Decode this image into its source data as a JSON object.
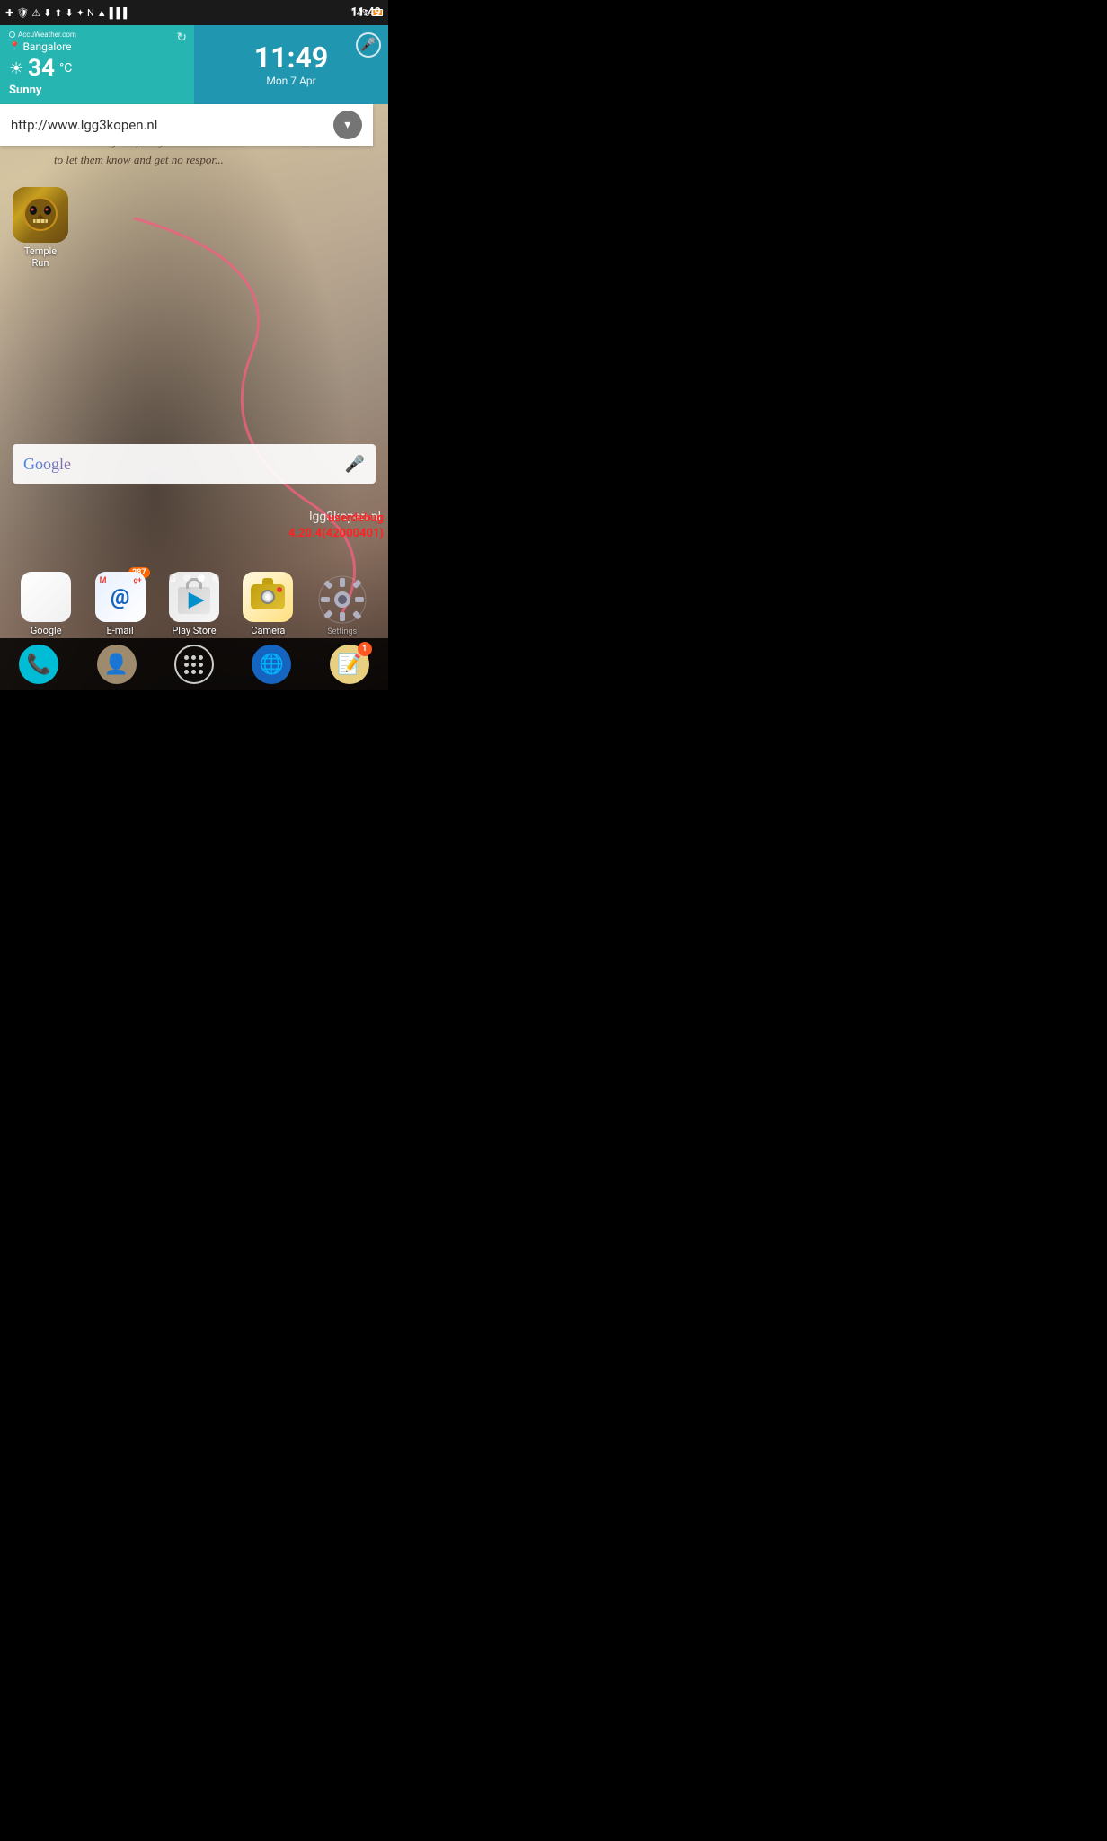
{
  "statusBar": {
    "time": "11:49",
    "battery": "14%",
    "icons": [
      "add",
      "shield",
      "warning",
      "download-in",
      "download-out",
      "download2",
      "bluetooth",
      "nfc",
      "wifi",
      "signal",
      "battery"
    ]
  },
  "weather": {
    "provider": "AccuWeather.com",
    "location": "Bangalore",
    "temperature": "34",
    "unit": "°C",
    "condition": "Sunny",
    "time": "11:49",
    "date": "Mon 7 Apr"
  },
  "urlBar": {
    "url": "http://www.lgg3kopen.nl"
  },
  "quote": {
    "text": "It's better to just quietly miss someo... to let them know and get no respor..."
  },
  "apps": {
    "templeRun": {
      "label": "Temple Run",
      "label_line1": "Temple",
      "label_line2": "Run"
    }
  },
  "google": {
    "label": "Google"
  },
  "dock": {
    "items": [
      {
        "id": "google",
        "label": "Google",
        "badge": null
      },
      {
        "id": "email",
        "label": "E-mail",
        "badge": "287"
      },
      {
        "id": "playstore",
        "label": "Play Store",
        "badge": null
      },
      {
        "id": "camera",
        "label": "Camera",
        "badge": null
      },
      {
        "id": "settings",
        "label": "Settings",
        "badge": null
      }
    ]
  },
  "debugText": {
    "line1": "userdebug",
    "line2": "4.20.4(42000401)"
  },
  "watermark": "lgg3kopen.nl",
  "navDots": {
    "count": 3,
    "activeIndex": 1,
    "showG": true
  },
  "systemBar": {
    "buttons": [
      {
        "id": "phone",
        "icon": "📞"
      },
      {
        "id": "contacts",
        "icon": "👤"
      },
      {
        "id": "apps",
        "icon": "apps"
      },
      {
        "id": "browser",
        "icon": "🌐"
      },
      {
        "id": "notes",
        "icon": "📝",
        "badge": "1"
      }
    ]
  }
}
